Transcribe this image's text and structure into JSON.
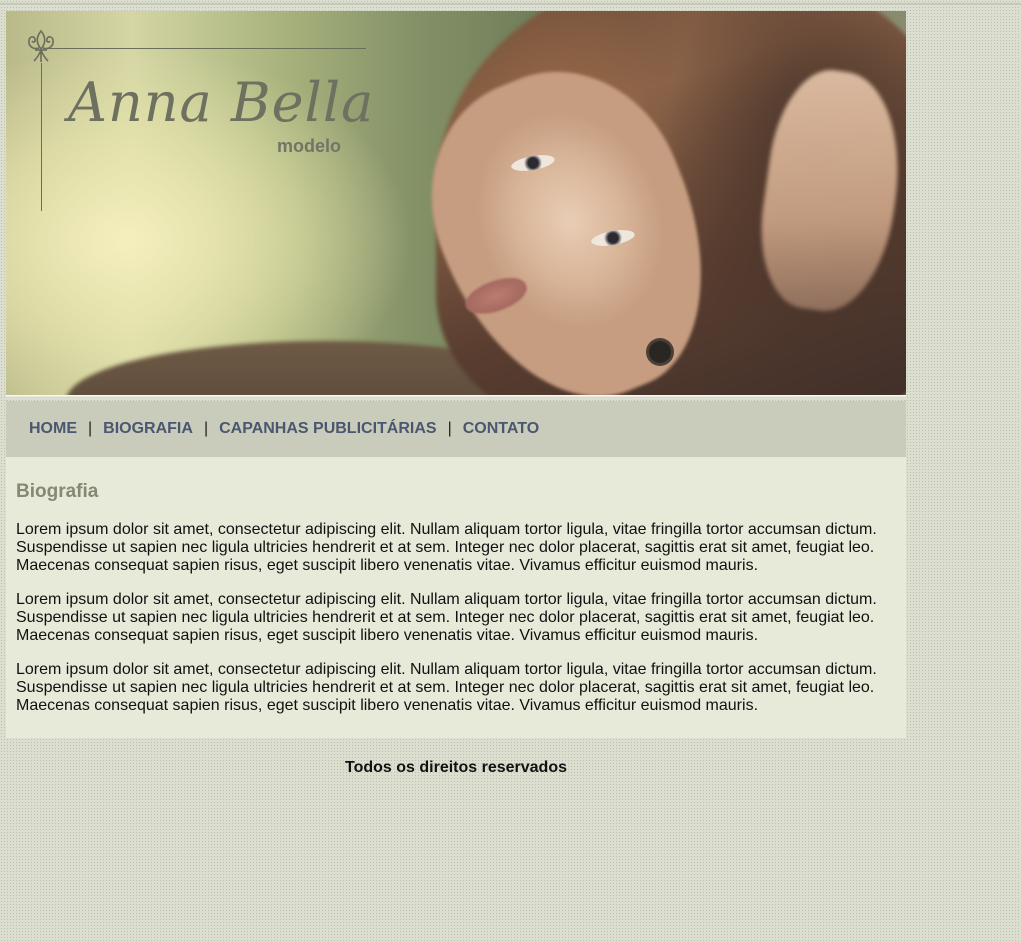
{
  "header": {
    "logo_name": "Anna Bella",
    "logo_subtitle": "modelo"
  },
  "nav": {
    "items": [
      {
        "label": "HOME"
      },
      {
        "label": "BIOGRAFIA"
      },
      {
        "label": "CAPANHAS PUBLICITÁRIAS"
      },
      {
        "label": "CONTATO"
      }
    ],
    "separator": "|"
  },
  "main": {
    "title": "Biografia",
    "paragraphs": [
      "Lorem ipsum dolor sit amet, consectetur adipiscing elit. Nullam aliquam tortor ligula, vitae fringilla tortor accumsan dictum. Suspendisse ut sapien nec ligula ultricies hendrerit et at sem. Integer nec dolor placerat, sagittis erat sit amet, feugiat leo. Maecenas consequat sapien risus, eget suscipit libero venenatis vitae. Vivamus efficitur euismod mauris.",
      "Lorem ipsum dolor sit amet, consectetur adipiscing elit. Nullam aliquam tortor ligula, vitae fringilla tortor accumsan dictum. Suspendisse ut sapien nec ligula ultricies hendrerit et at sem. Integer nec dolor placerat, sagittis erat sit amet, feugiat leo. Maecenas consequat sapien risus, eget suscipit libero venenatis vitae. Vivamus efficitur euismod mauris.",
      "Lorem ipsum dolor sit amet, consectetur adipiscing elit. Nullam aliquam tortor ligula, vitae fringilla tortor accumsan dictum. Suspendisse ut sapien nec ligula ultricies hendrerit et at sem. Integer nec dolor placerat, sagittis erat sit amet, feugiat leo. Maecenas consequat sapien risus, eget suscipit libero venenatis vitae. Vivamus efficitur euismod mauris."
    ]
  },
  "footer": {
    "text": "Todos os direitos reservados"
  },
  "icons": {
    "logo_ornament": "fleur-de-lis-icon"
  },
  "colors": {
    "nav_link": "#4b5670",
    "nav_background": "#c9ccbb",
    "content_background": "#e7e9d9",
    "heading": "#868874",
    "page_background": "#dcdfd0"
  }
}
